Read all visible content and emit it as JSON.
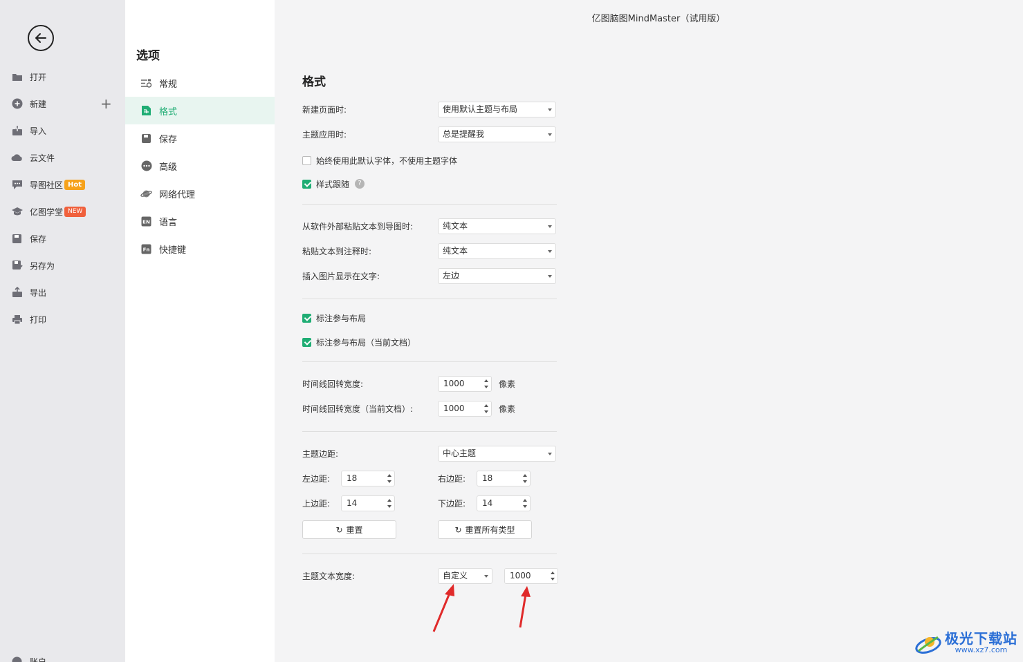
{
  "window": {
    "title": "亿图脑图MindMaster（试用版）"
  },
  "leftnav": {
    "items": [
      {
        "label": "打开",
        "icon": "folder-icon"
      },
      {
        "label": "新建",
        "icon": "plus-circle-icon"
      },
      {
        "label": "导入",
        "icon": "import-icon"
      },
      {
        "label": "云文件",
        "icon": "cloud-icon"
      },
      {
        "label": "导图社区",
        "icon": "community-icon",
        "badge": "Hot"
      },
      {
        "label": "亿图学堂",
        "icon": "graduation-cap-icon",
        "badge": "NEW"
      },
      {
        "label": "保存",
        "icon": "save-icon"
      },
      {
        "label": "另存为",
        "icon": "save-as-icon"
      },
      {
        "label": "导出",
        "icon": "export-icon"
      },
      {
        "label": "打印",
        "icon": "printer-icon"
      }
    ],
    "account_label": "账户"
  },
  "options": {
    "title": "选项",
    "items": [
      {
        "label": "常规",
        "icon": "sliders-icon"
      },
      {
        "label": "格式",
        "icon": "format-icon",
        "active": true
      },
      {
        "label": "保存",
        "icon": "save-icon"
      },
      {
        "label": "高级",
        "icon": "more-icon"
      },
      {
        "label": "网络代理",
        "icon": "planet-icon"
      },
      {
        "label": "语言",
        "icon": "language-icon",
        "icon_text": "EN"
      },
      {
        "label": "快捷键",
        "icon": "shortcut-icon",
        "icon_text": "Fn"
      }
    ]
  },
  "format": {
    "title": "格式",
    "new_page": {
      "label": "新建页面时:",
      "value": "使用默认主题与布局"
    },
    "theme_apply": {
      "label": "主题应用时:",
      "value": "总是提醒我"
    },
    "always_default_font": {
      "label": "始终使用此默认字体，不使用主题字体",
      "checked": false
    },
    "style_follow": {
      "label": "样式跟随",
      "checked": true
    },
    "paste_external": {
      "label": "从软件外部粘贴文本到导图时:",
      "value": "纯文本"
    },
    "paste_note": {
      "label": "粘贴文本到注释时:",
      "value": "纯文本"
    },
    "insert_image": {
      "label": "插入图片显示在文字:",
      "value": "左边"
    },
    "callout_layout": {
      "label": "标注参与布局",
      "checked": true
    },
    "callout_layout_doc": {
      "label": "标注参与布局（当前文档）",
      "checked": true
    },
    "timeline_width": {
      "label": "时间线回转宽度:",
      "value": "1000",
      "unit": "像素"
    },
    "timeline_width_doc": {
      "label": "时间线回转宽度（当前文档）:",
      "value": "1000",
      "unit": "像素"
    },
    "topic_margin": {
      "label": "主题边距:",
      "value": "中心主题"
    },
    "left_margin": {
      "label": "左边距:",
      "value": "18"
    },
    "right_margin": {
      "label": "右边距:",
      "value": "18"
    },
    "top_margin": {
      "label": "上边距:",
      "value": "14"
    },
    "bottom_margin": {
      "label": "下边距:",
      "value": "14"
    },
    "reset_label": "重置",
    "reset_all_label": "重置所有类型",
    "topic_text_width": {
      "label": "主题文本宽度:",
      "mode": "自定义",
      "value": "1000"
    }
  },
  "watermark": {
    "text": "极光下载站",
    "url": "www.xz7.com"
  },
  "colors": {
    "accent": "#1fad74",
    "annotation_arrow": "#e02a2a"
  }
}
